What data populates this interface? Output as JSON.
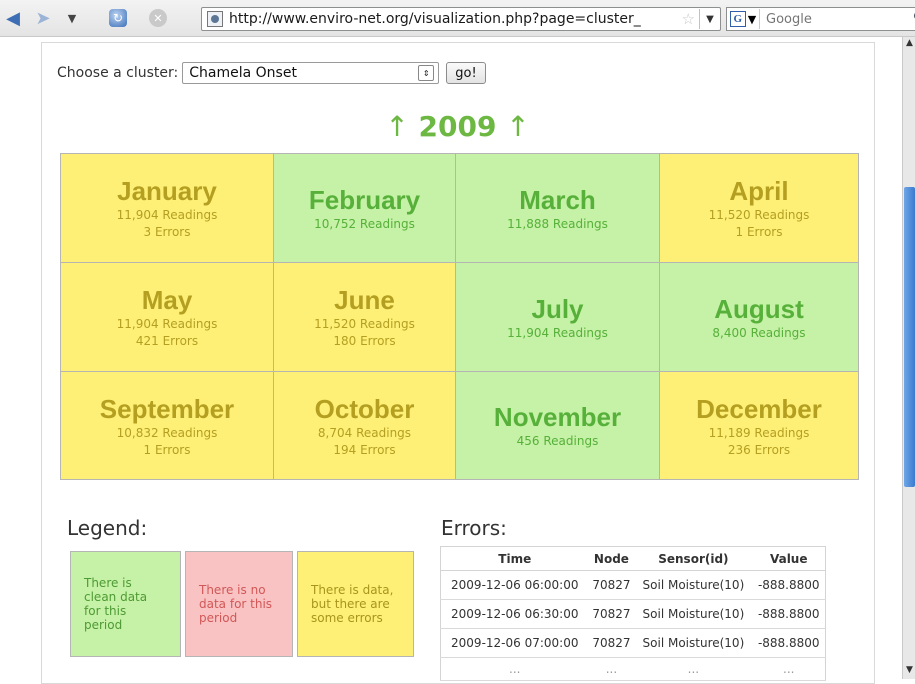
{
  "browser": {
    "url": "http://www.enviro-net.org/visualization.php?page=cluster_",
    "search_placeholder": "Google"
  },
  "chooser": {
    "label": "Choose a cluster:",
    "selected": "Chamela Onset",
    "go_label": "go!"
  },
  "year": {
    "up_arrow_left": "↑",
    "value": "2009",
    "up_arrow_right": "↑"
  },
  "months": [
    {
      "name": "January",
      "readings": "11,904 Readings",
      "errors": "3 Errors",
      "status": "yellow"
    },
    {
      "name": "February",
      "readings": "10,752 Readings",
      "errors": "",
      "status": "green"
    },
    {
      "name": "March",
      "readings": "11,888 Readings",
      "errors": "",
      "status": "green"
    },
    {
      "name": "April",
      "readings": "11,520 Readings",
      "errors": "1 Errors",
      "status": "yellow"
    },
    {
      "name": "May",
      "readings": "11,904 Readings",
      "errors": "421 Errors",
      "status": "yellow"
    },
    {
      "name": "June",
      "readings": "11,520 Readings",
      "errors": "180 Errors",
      "status": "yellow"
    },
    {
      "name": "July",
      "readings": "11,904 Readings",
      "errors": "",
      "status": "green"
    },
    {
      "name": "August",
      "readings": "8,400 Readings",
      "errors": "",
      "status": "green"
    },
    {
      "name": "September",
      "readings": "10,832 Readings",
      "errors": "1 Errors",
      "status": "yellow"
    },
    {
      "name": "October",
      "readings": "8,704 Readings",
      "errors": "194 Errors",
      "status": "yellow"
    },
    {
      "name": "November",
      "readings": "456 Readings",
      "errors": "",
      "status": "green"
    },
    {
      "name": "December",
      "readings": "11,189 Readings",
      "errors": "236 Errors",
      "status": "yellow"
    }
  ],
  "colors": {
    "clean": "#c5f2a6",
    "no_data": "#f9c3c3",
    "errors": "#fef077",
    "year_green": "#6cb842"
  },
  "legend": {
    "title": "Legend:",
    "clean": "There is clean data for this period",
    "no_data": "There is no data for this period",
    "errors": "There is data, but there are some errors"
  },
  "errors": {
    "title": "Errors:",
    "columns": [
      "Time",
      "Node",
      "Sensor(id)",
      "Value"
    ],
    "rows": [
      [
        "2009-12-06 06:00:00",
        "70827",
        "Soil Moisture(10)",
        "-888.8800"
      ],
      [
        "2009-12-06 06:30:00",
        "70827",
        "Soil Moisture(10)",
        "-888.8800"
      ],
      [
        "2009-12-06 07:00:00",
        "70827",
        "Soil Moisture(10)",
        "-888.8800"
      ],
      [
        "...",
        "...",
        "...",
        "..."
      ]
    ]
  }
}
